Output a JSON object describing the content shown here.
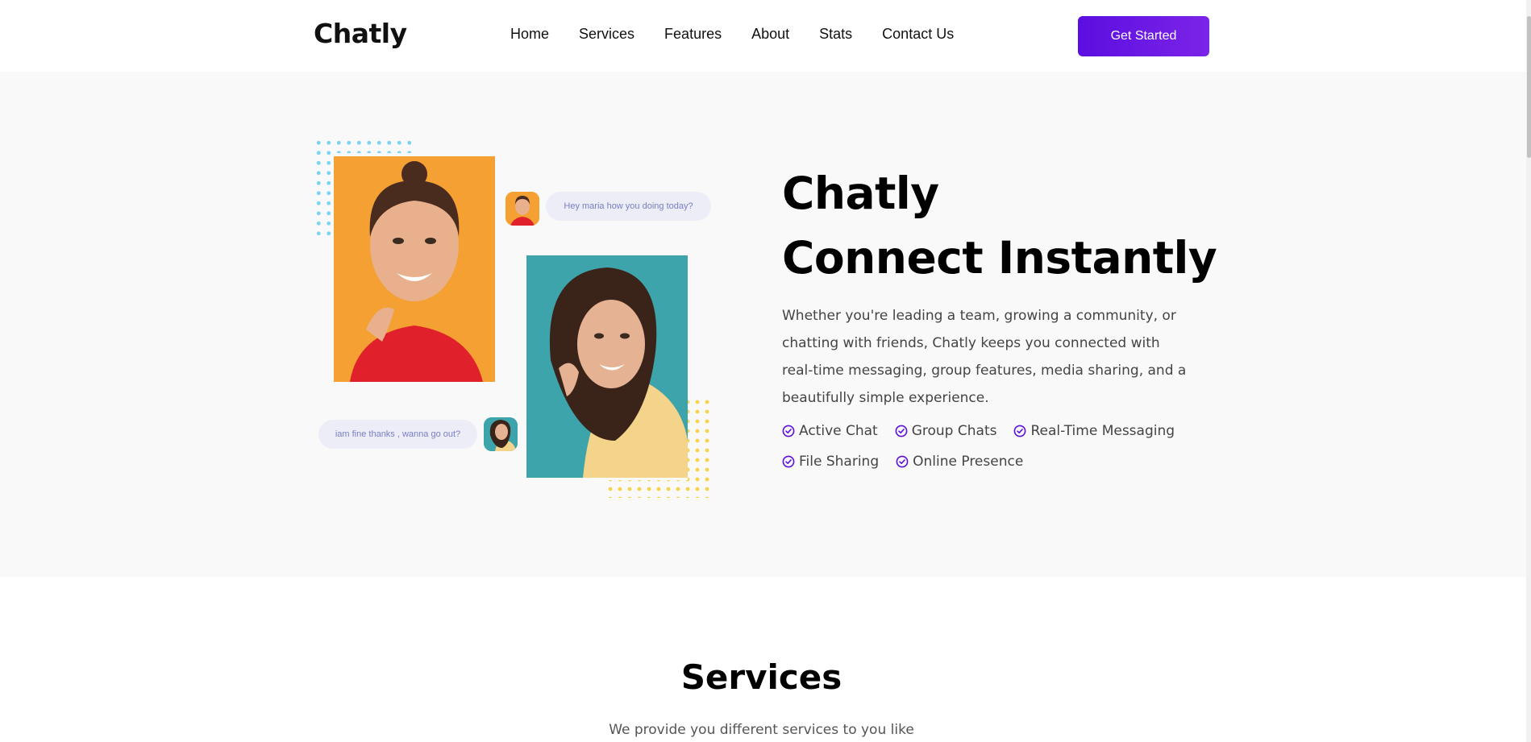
{
  "nav": {
    "logo": "Chatly",
    "links": [
      "Home",
      "Services",
      "Features",
      "About",
      "Stats",
      "Contact Us"
    ],
    "cta_label": "Get Started"
  },
  "hero": {
    "title_line1": "Chatly",
    "title_line2": "Connect Instantly",
    "description": "Whether you're leading a team, growing a community, or chatting with friends, Chatly keeps you connected with real-time messaging, group features, media sharing, and a beautifully simple experience.",
    "features": [
      "Active Chat",
      "Group Chats",
      "Real-Time Messaging",
      "File Sharing",
      "Online Presence"
    ],
    "bubble_top": "Hey maria how you doing today?",
    "bubble_bottom": "iam fine thanks , wanna go out?"
  },
  "services": {
    "title": "Services",
    "subtitle": "We provide you different services to you like"
  },
  "colors": {
    "accent": "#5b0ee0",
    "check": "#5b0ee0",
    "hero_bg": "#f9f9f9",
    "photo_orange": "#f5a032",
    "photo_teal": "#3ea4ab",
    "dots_blue": "#7dd3f5",
    "dots_yellow": "#f7d34a"
  },
  "icons": {
    "check": "check-circle-icon"
  }
}
